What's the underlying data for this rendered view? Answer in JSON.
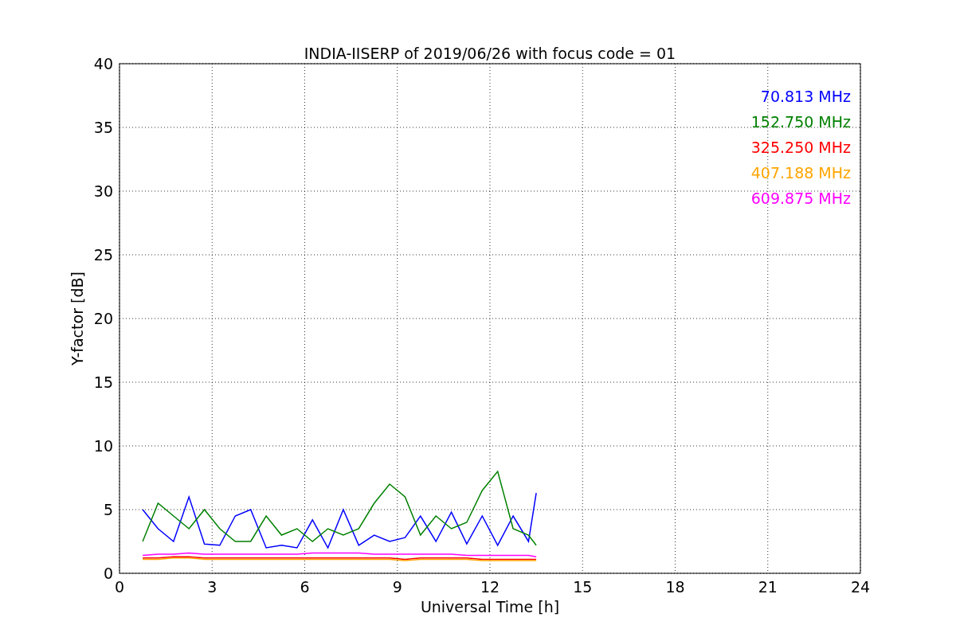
{
  "figure": {
    "chart_data": {
      "type": "line",
      "title": "INDIA-IISERP of 2019/06/26 with focus code = 01",
      "xlabel": "Universal Time [h]",
      "ylabel": "Y-factor [dB]",
      "x": [
        0.75,
        1.25,
        1.75,
        2.25,
        2.75,
        3.25,
        3.75,
        4.25,
        4.75,
        5.25,
        5.75,
        6.25,
        6.75,
        7.25,
        7.75,
        8.25,
        8.75,
        9.25,
        9.75,
        10.25,
        10.75,
        11.25,
        11.75,
        12.25,
        12.75,
        13.25,
        13.5
      ],
      "series": [
        {
          "name": "70.813 MHz",
          "color": "#0000ff",
          "values": [
            5.0,
            3.5,
            2.5,
            6.0,
            2.3,
            2.2,
            4.5,
            5.0,
            2.0,
            2.2,
            2.0,
            4.2,
            2.0,
            5.0,
            2.2,
            3.0,
            2.5,
            2.8,
            4.5,
            2.5,
            4.8,
            2.3,
            4.5,
            2.2,
            4.5,
            2.5,
            6.3
          ]
        },
        {
          "name": "152.750 MHz",
          "color": "#008000",
          "values": [
            2.5,
            5.5,
            4.5,
            3.5,
            5.0,
            3.5,
            2.5,
            2.5,
            4.5,
            3.0,
            3.5,
            2.5,
            3.5,
            3.0,
            3.5,
            5.5,
            7.0,
            6.0,
            3.0,
            4.5,
            3.5,
            4.0,
            6.5,
            8.0,
            3.5,
            3.0,
            2.2
          ]
        },
        {
          "name": "325.250 MHz",
          "color": "#ff0000",
          "values": [
            1.2,
            1.2,
            1.3,
            1.3,
            1.2,
            1.2,
            1.2,
            1.2,
            1.2,
            1.2,
            1.2,
            1.2,
            1.2,
            1.2,
            1.2,
            1.2,
            1.2,
            1.1,
            1.2,
            1.2,
            1.2,
            1.2,
            1.1,
            1.1,
            1.1,
            1.1,
            1.1
          ]
        },
        {
          "name": "407.188 MHz",
          "color": "#ffa500",
          "values": [
            1.1,
            1.1,
            1.2,
            1.2,
            1.1,
            1.1,
            1.1,
            1.1,
            1.1,
            1.1,
            1.1,
            1.1,
            1.1,
            1.1,
            1.1,
            1.1,
            1.1,
            1.0,
            1.1,
            1.1,
            1.1,
            1.1,
            1.0,
            1.0,
            1.0,
            1.0,
            1.0
          ]
        },
        {
          "name": "609.875 MHz",
          "color": "#ff00ff",
          "values": [
            1.4,
            1.5,
            1.5,
            1.6,
            1.5,
            1.5,
            1.5,
            1.5,
            1.5,
            1.5,
            1.5,
            1.6,
            1.6,
            1.6,
            1.6,
            1.5,
            1.5,
            1.5,
            1.5,
            1.5,
            1.5,
            1.4,
            1.4,
            1.4,
            1.4,
            1.4,
            1.3
          ]
        }
      ],
      "xlim": [
        0,
        24
      ],
      "ylim": [
        0,
        40
      ],
      "xticks": [
        0,
        3,
        6,
        9,
        12,
        15,
        18,
        21,
        24
      ],
      "yticks": [
        0,
        5,
        10,
        15,
        20,
        25,
        30,
        35,
        40
      ],
      "grid": true
    }
  }
}
